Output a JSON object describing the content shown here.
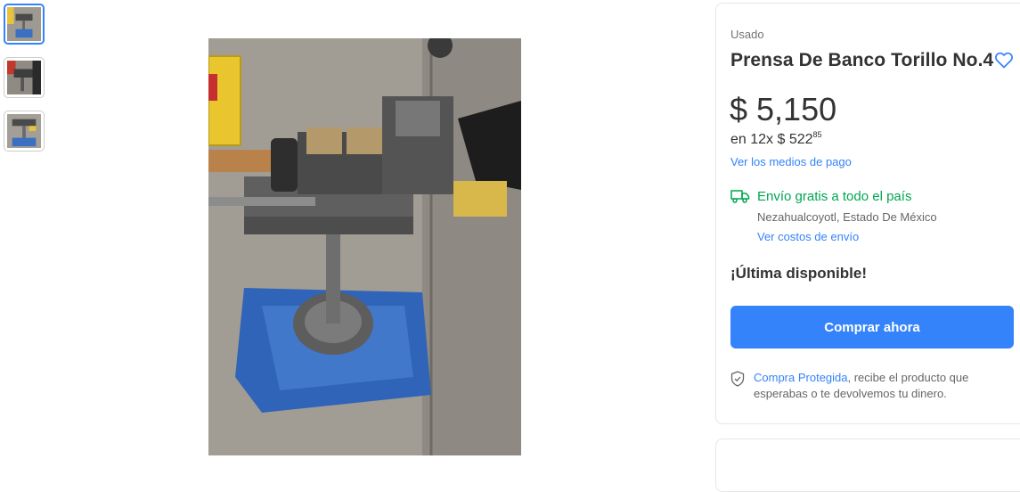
{
  "gallery": {
    "thumbnails": [
      "Foto 1",
      "Foto 2",
      "Foto 3"
    ],
    "selected_index": 0
  },
  "product": {
    "condition": "Usado",
    "title": "Prensa De Banco Torillo No.4",
    "price": "$ 5,150",
    "installments_prefix": "en 12x $ 522",
    "installments_cents": "85",
    "payment_link": "Ver los medios de pago",
    "shipping_text": "Envío gratis a todo el país",
    "location": "Nezahualcoyotl, Estado De México",
    "shipping_link": "Ver costos de envío",
    "stock": "¡Última disponible!",
    "buy_button": "Comprar ahora",
    "protected_link": "Compra Protegida",
    "protected_text": ", recibe el producto que esperabas o te devolvemos tu dinero."
  },
  "icons": {
    "favorite": "heart-icon",
    "shipping": "truck-icon",
    "protection": "shield-check-icon"
  },
  "colors": {
    "accent": "#3483fa",
    "shipping_green": "#00a650"
  }
}
